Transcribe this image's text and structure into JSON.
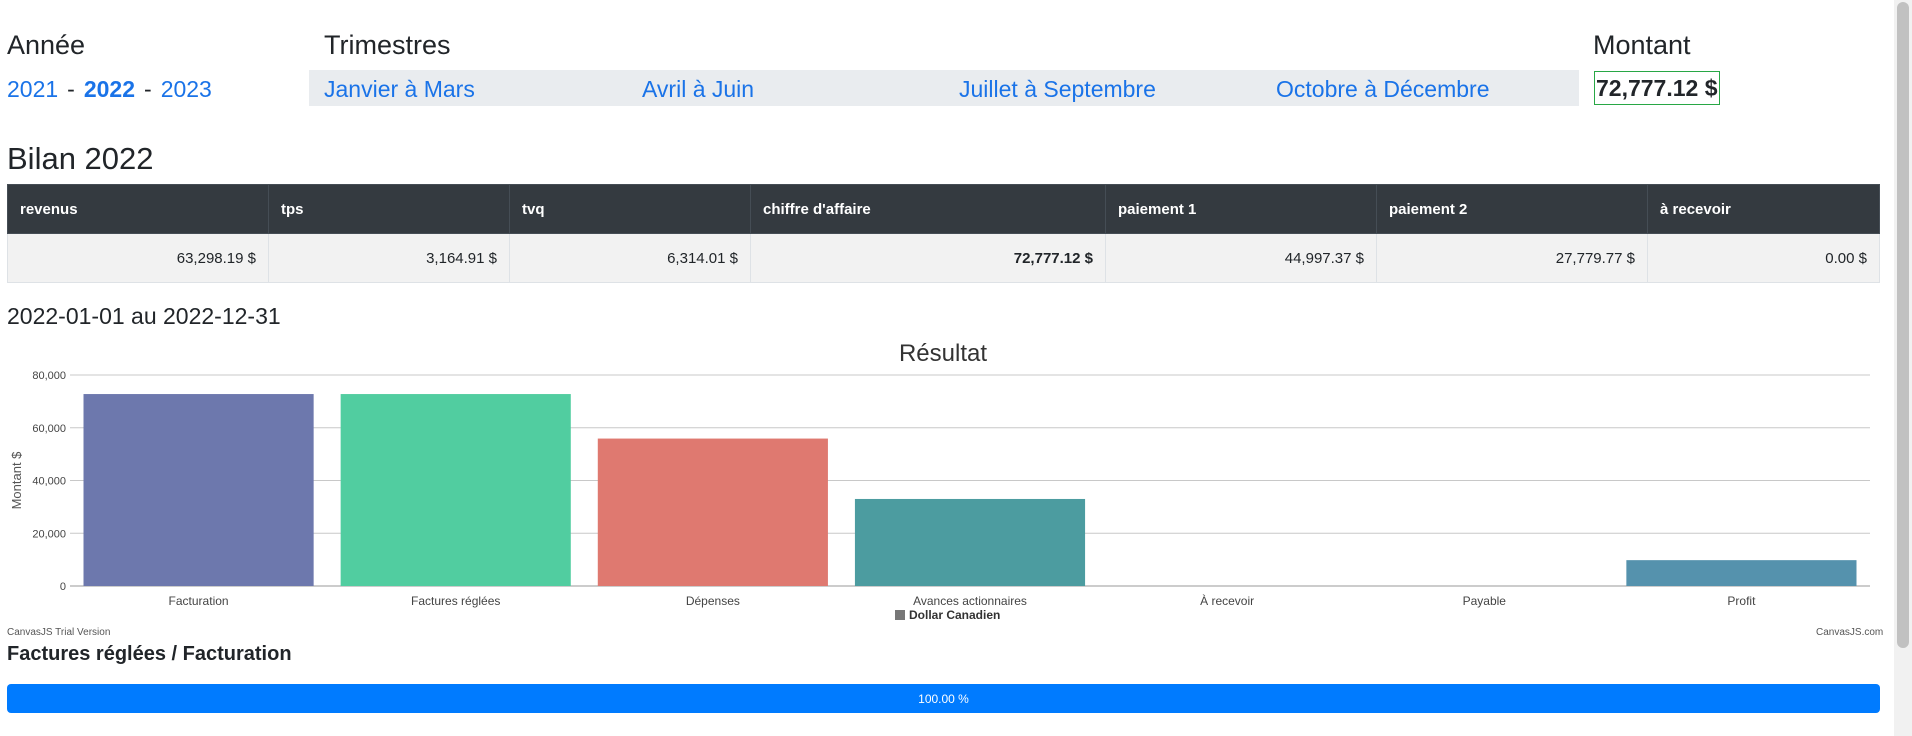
{
  "filters": {
    "annee_label": "Année",
    "years": [
      "2021",
      "2022",
      "2023"
    ],
    "year_separator": "-",
    "selected_year": "2022",
    "trimestres_label": "Trimestres",
    "quarters": [
      "Janvier à Mars",
      "Avril à Juin",
      "Juillet à Septembre",
      "Octobre à Décembre"
    ],
    "montant_label": "Montant",
    "montant_value": "72,777.12 $"
  },
  "bilan": {
    "title": "Bilan 2022",
    "columns": [
      "revenus",
      "tps",
      "tvq",
      "chiffre d'affaire",
      "paiement 1",
      "paiement 2",
      "à recevoir"
    ],
    "row": [
      "63,298.19 $",
      "3,164.91 $",
      "6,314.01 $",
      "72,777.12 $",
      "44,997.37 $",
      "27,779.77 $",
      "0.00 $"
    ]
  },
  "period": "2022-01-01 au 2022-12-31",
  "chart_data": {
    "type": "bar",
    "title": "Résultat",
    "ylabel": "Montant $",
    "xlabel": "",
    "ylim": [
      0,
      80000
    ],
    "yticks": [
      "0",
      "20,000",
      "40,000",
      "60,000",
      "80,000"
    ],
    "grid": true,
    "legend": "bottom-center",
    "categories": [
      "Facturation",
      "Factures réglées",
      "Dépenses",
      "Avances actionnaires",
      "À recevoir",
      "Payable",
      "Profit"
    ],
    "series": [
      {
        "name": "Dollar Canadien",
        "values": [
          72777.12,
          72777.12,
          55900,
          33000,
          0,
          0,
          9800
        ],
        "colors": [
          "#6d78ad",
          "#51cda0",
          "#df7970",
          "#4c9ca0",
          "#ae7d99",
          "#c9d45c",
          "#5592ad"
        ]
      }
    ]
  },
  "watermarks": {
    "trial": "CanvasJS Trial Version",
    "site": "CanvasJS.com"
  },
  "progress": {
    "title": "Factures réglées / Facturation",
    "percent": 100,
    "label": "100.00 %",
    "color": "#007bff"
  }
}
